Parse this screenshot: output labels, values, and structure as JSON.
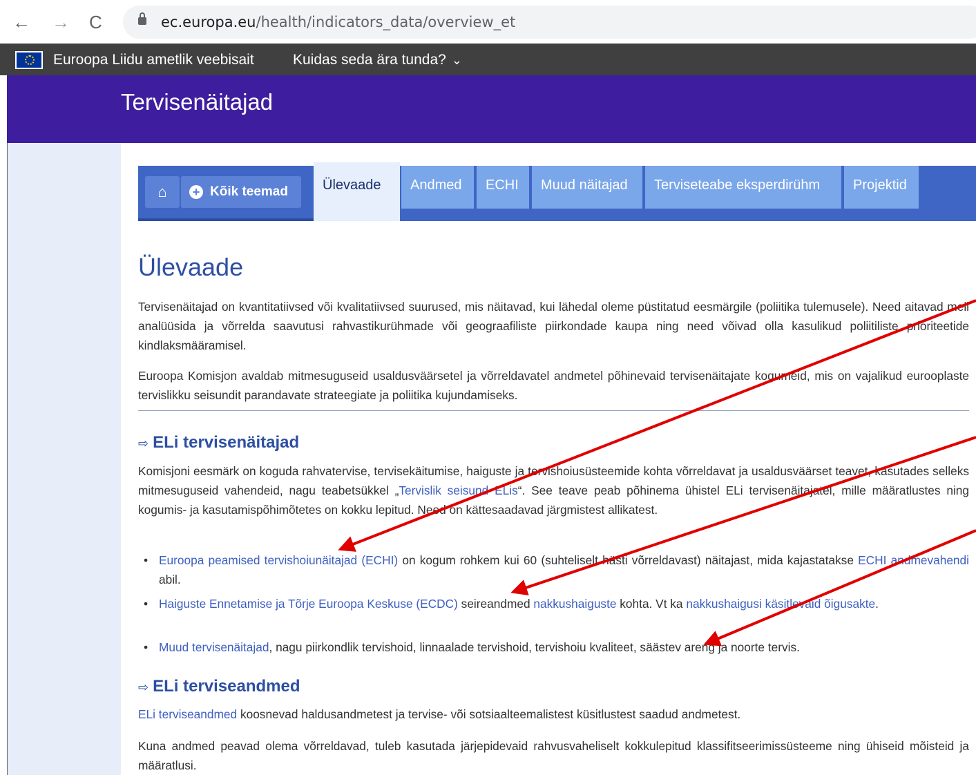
{
  "browser": {
    "back_icon": "←",
    "forward_icon": "→",
    "reload_icon": "C",
    "url_domain": "ec.europa.eu",
    "url_path": "/health/indicators_data/overview_et"
  },
  "eubar": {
    "official_text": "Euroopa Liidu ametlik veebisait",
    "how_text": "Kuidas seda ära tunda?"
  },
  "site": {
    "title": "Tervisenäitajad"
  },
  "nav": {
    "all_topics": "Kõik teemad",
    "tabs": [
      "Ülevaade",
      "Andmed",
      "ECHI",
      "Muud näitajad",
      "Terviseteabe eksperdirühm",
      "Projektid"
    ]
  },
  "content": {
    "heading": "Ülevaade",
    "p1": "Tervisenäitajad on kvantitatiivsed või kvalitatiivsed suurused, mis näitavad, kui lähedal oleme püstitatud eesmärgile (poliitika tulemusele). Need aitavad meil analüüsida ja võrrelda saavutusi rahvastikurühmade või geograafiliste piirkondade kaupa ning need võivad olla kasulikud poliitiliste prioriteetide kindlaksmääramisel.",
    "p2": "Euroopa Komisjon avaldab mitmesuguseid usaldusväärsetel ja võrreldavatel andmetel põhinevaid tervisenäitajate kogumeid, mis on vajalikud eurooplaste tervislikku seisundit parandavate strateegiate ja poliitika kujundamiseks.",
    "section1_title": "ELi tervisenäitajad",
    "p3_before": "Komisjoni eesmärk on koguda rahvatervise, tervisekäitumise, haiguste ja tervishoiusüsteemide kohta võrreldavat ja usaldusväärset teavet, kasutades selleks mitmesuguseid vahendeid, nagu teabetsükkel „",
    "p3_link": "Tervislik seisund ELis",
    "p3_after": "“. See teave peab põhinema ühistel ELi tervisenäitajatel, mille määratlustes ning kogumis- ja kasutamispõhimõtetes on kokku lepitud. Need on kättesaadavad järgmistest allikatest.",
    "li1_link": "Euroopa peamised tervishoiunäitajad (ECHI)",
    "li1_text": " on kogum rohkem kui 60 (suhteliselt hästi võrreldavast) näitajast, mida kajastatakse ",
    "li1_link2": "ECHI andmevahendi",
    "li1_text2": " abil.",
    "li2_link": "Haiguste Ennetamise ja Tõrje Euroopa Keskuse (ECDC)",
    "li2_text": " seireandmed ",
    "li2_link2": "nakkushaiguste",
    "li2_text2": " kohta. Vt ka ",
    "li2_link3": "nakkushaigusi käsitlevaid õigusakte",
    "li2_text3": ".",
    "li3_link": "Muud tervisenäitajad",
    "li3_text": ", nagu piirkondlik tervishoid, linnaalade tervishoid, tervishoiu kvaliteet, säästev areng ja noorte tervis.",
    "section2_title": "ELi terviseandmed",
    "p4_link": "ELi terviseandmed",
    "p4_text": " koosnevad haldusandmetest ja tervise- või sotsiaalteemalistest küsitlustest saadud andmetest.",
    "p5": "Kuna andmed peavad olema võrreldavad, tuleb kasutada järjepidevaid rahvusvaheliselt kokkulepitud klassifitseerimissüsteeme ning ühiseid mõisteid ja määratlusi."
  },
  "colors": {
    "header_bg": "#3e1e9e",
    "tab_bg": "#3f66c4",
    "tab_item": "#7aa6ea",
    "link": "#3d5fc0",
    "annotation_arrow": "#e00000"
  }
}
